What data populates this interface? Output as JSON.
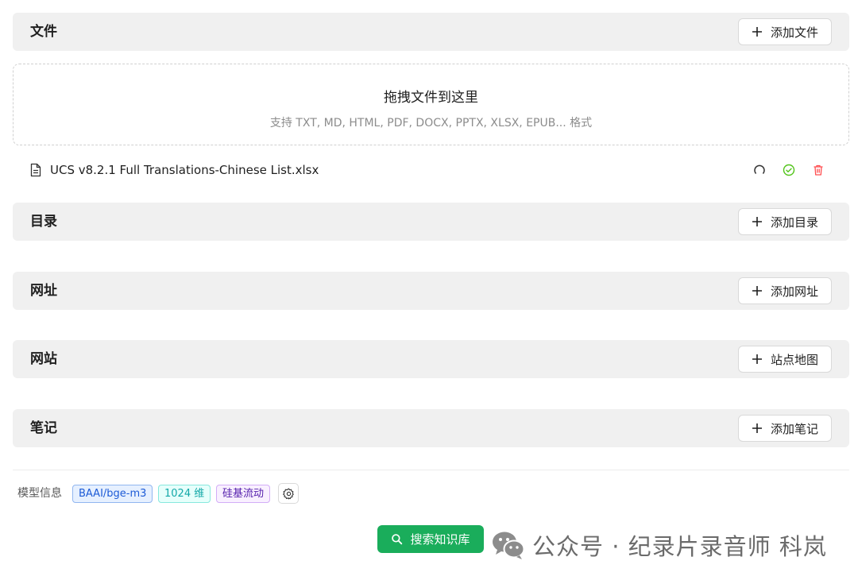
{
  "sections": {
    "files": {
      "title": "文件",
      "button": "添加文件"
    },
    "folders": {
      "title": "目录",
      "button": "添加目录"
    },
    "urls": {
      "title": "网址",
      "button": "添加网址"
    },
    "sites": {
      "title": "网站",
      "button": "站点地图"
    },
    "notes": {
      "title": "笔记",
      "button": "添加笔记"
    }
  },
  "dropzone": {
    "title": "拖拽文件到这里",
    "hint": "支持 TXT, MD, HTML, PDF, DOCX, PPTX, XLSX, EPUB... 格式"
  },
  "file": {
    "name": "UCS v8.2.1 Full Translations-Chinese List.xlsx",
    "icons": [
      "file-icon",
      "refresh-icon",
      "check-circle-icon",
      "trash-icon"
    ]
  },
  "model": {
    "label": "模型信息",
    "name": "BAAI/bge-m3",
    "dimensions": "1024 维",
    "provider": "硅基流动"
  },
  "search_button": "搜索知识库",
  "watermark": "公众号 · 纪录片录音师 科岚",
  "colors": {
    "accent": "#1aad5b",
    "success": "#52c41a",
    "danger": "#ff4d4f"
  }
}
